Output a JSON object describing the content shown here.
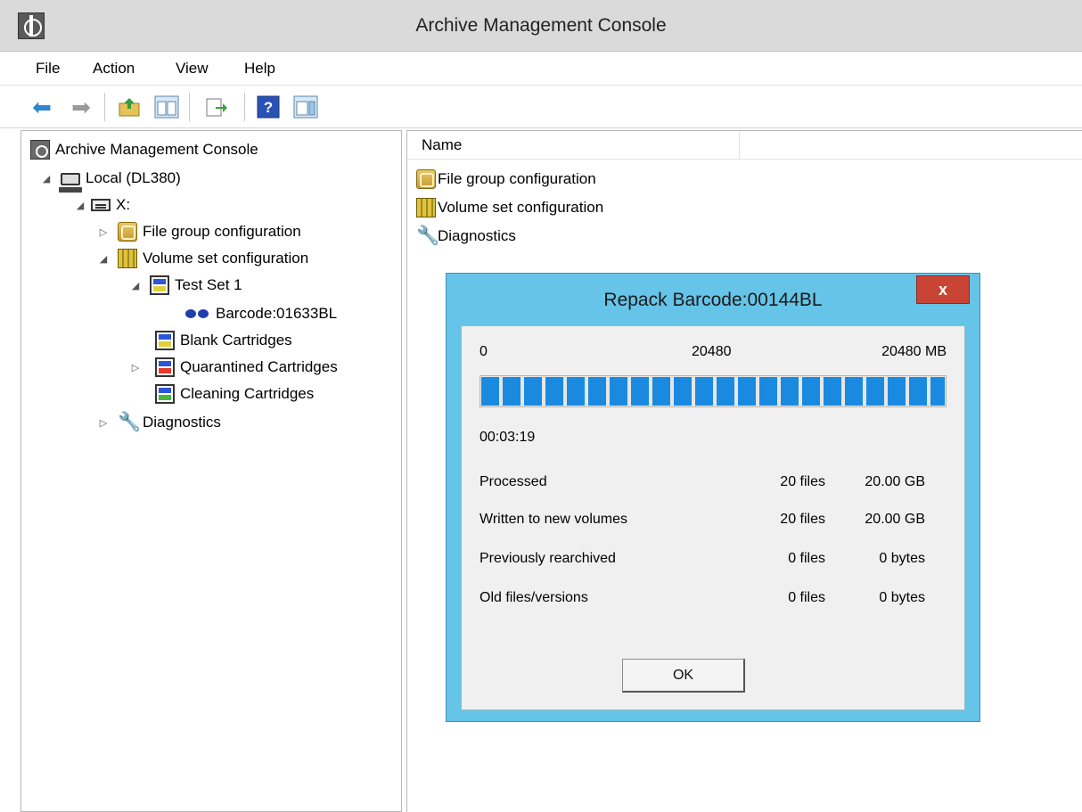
{
  "window": {
    "title": "Archive Management Console",
    "app_icon": "console-icon"
  },
  "menu": [
    "File",
    "Action",
    "View",
    "Help"
  ],
  "toolbar": {
    "buttons": [
      "back-icon",
      "forward-icon",
      "up-folder-icon",
      "show-tree-icon",
      "export-list-icon",
      "help-icon",
      "show-action-pane-icon"
    ],
    "colors": {
      "arrow": "#2f86cf",
      "arrow_disabled": "#9a9a9a"
    }
  },
  "tree": {
    "root": "Archive Management Console",
    "local": "Local (DL380)",
    "drive": "X:",
    "file_group": "File group configuration",
    "volume_set": "Volume set configuration",
    "test_set": "Test Set 1",
    "barcode": "Barcode:01633BL",
    "blank": "Blank Cartridges",
    "quarantined": "Quarantined Cartridges",
    "cleaning": "Cleaning Cartridges",
    "diagnostics": "Diagnostics"
  },
  "list": {
    "column_name": "Name",
    "items": [
      "File group configuration",
      "Volume set configuration",
      "Diagnostics"
    ]
  },
  "dialog": {
    "title": "Repack Barcode:00144BL",
    "close_label": "x",
    "scale": {
      "min": "0",
      "mid": "20480",
      "max": "20480 MB"
    },
    "progress_fraction": 1.0,
    "elapsed": "00:03:19",
    "stats": [
      {
        "label": "Processed",
        "files": "20 files",
        "size": "20.00 GB"
      },
      {
        "label": "Written to new volumes",
        "files": "20 files",
        "size": "20.00 GB"
      },
      {
        "label": "Previously rearchived",
        "files": "0 files",
        "size": "0 bytes"
      },
      {
        "label": "Old files/versions",
        "files": "0 files",
        "size": "0 bytes"
      }
    ],
    "ok_label": "OK",
    "colors": {
      "frame": "#65c4e8",
      "close": "#c94434",
      "progress": "#1a8ae0"
    }
  }
}
